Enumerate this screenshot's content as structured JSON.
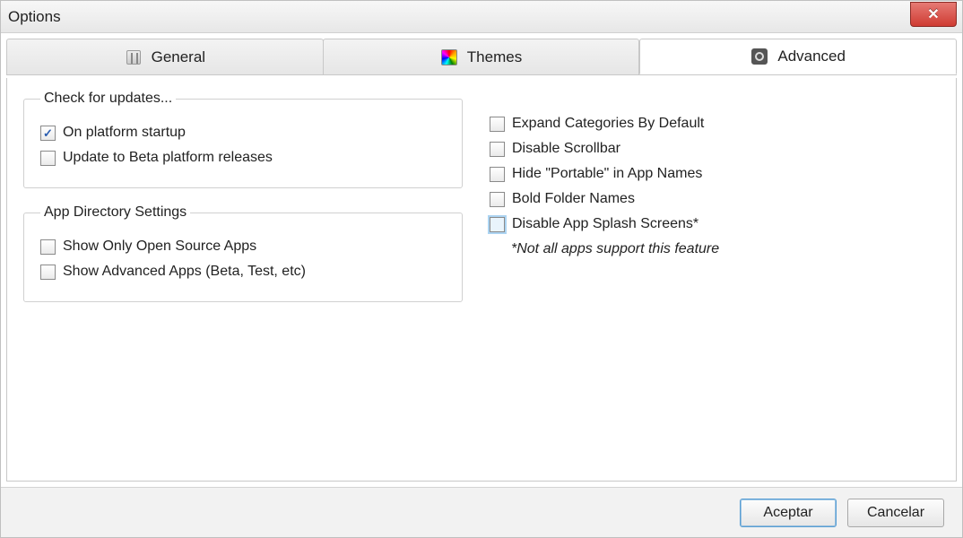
{
  "window": {
    "title": "Options"
  },
  "tabs": {
    "general": "General",
    "themes": "Themes",
    "advanced": "Advanced",
    "active": "advanced"
  },
  "groups": {
    "updates": {
      "legend": "Check for updates...",
      "on_startup": {
        "label": "On platform startup",
        "checked": true
      },
      "beta": {
        "label": "Update to Beta platform releases",
        "checked": false
      }
    },
    "directory": {
      "legend": "App Directory Settings",
      "open_source": {
        "label": "Show Only Open Source Apps",
        "checked": false
      },
      "advanced_apps": {
        "label": "Show Advanced Apps (Beta, Test, etc)",
        "checked": false
      }
    }
  },
  "right": {
    "expand_categories": {
      "label": "Expand Categories By Default",
      "checked": false
    },
    "disable_scrollbar": {
      "label": "Disable Scrollbar",
      "checked": false
    },
    "hide_portable": {
      "label": "Hide \"Portable\" in App Names",
      "checked": false
    },
    "bold_folders": {
      "label": "Bold Folder Names",
      "checked": false
    },
    "disable_splash": {
      "label": "Disable App Splash Screens*",
      "checked": false,
      "highlight": true
    },
    "splash_note": "*Not all apps support this feature"
  },
  "buttons": {
    "ok": "Aceptar",
    "cancel": "Cancelar"
  }
}
